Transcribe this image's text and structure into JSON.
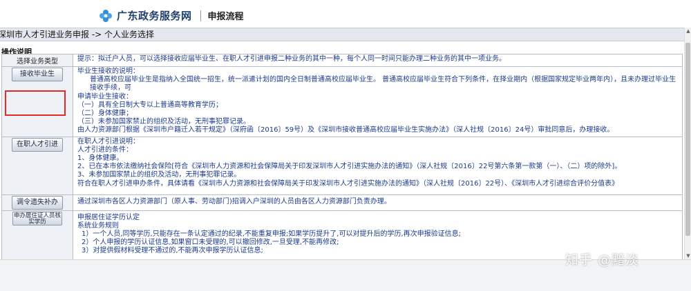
{
  "header": {
    "site_name": "广东政务服务网",
    "section": "申报流程"
  },
  "breadcrumb": "深圳市人才引进业务申报 -> 个人业务选择",
  "ops_title": "操作说明",
  "rows": [
    {
      "label": "选择业务类型",
      "lines": [
        "提示：拟迁户人员，可以选择接收应届毕业生、在职人才引进申报二种业务的其中一种，每个人同一时间只能办理二种业务的其中一项业务。"
      ]
    },
    {
      "label": "接收毕业生",
      "lines": [
        "毕业生接收的说明：",
        "普通高校应届毕业生是指纳入全国统一招生，统一派遣计划的国内全日制普通高校应届毕业生。 普通高校应届毕业生符合下列条件，在择业期内（根据国家规定毕业两年内），且未办理过毕业生接收手续，可",
        "申请毕业生接收：",
        "（一）具有全日制大专以上普通高等教育学历；",
        "（二）身体健康；",
        "（三）未参加国家禁止的组织及活动，无刑事犯罪记录。",
        "由人力资源部门根据《深圳市户籍迁入若干规定》（深府函〔2016〕59号）及《深圳市接收普通高校应届毕业生实施办法》（深人社规〔2016〕24号）审批同意后，办理接收。"
      ]
    },
    {
      "label": "在职人才引进",
      "lines": [
        "在职人才引进说明：",
        "人才引进的条件：",
        "1、身体健康。",
        "2、已在本市依法缴纳社会保险[符合《深圳市人力资源和社会保障局关于印发深圳市人才引进实施办法的通知》（深人社规〔2016〕22号第六条第一款第（一）、（二）项的除外]。",
        "3、未参加国家禁止的组织及活动，无刑事犯罪记录。",
        "符合在职人才引进申办条件，具体请看《深圳市人力资源和社会保障局关于印发深圳市人才引进实施办法的通知》（深人社规〔2016〕22号）、《深圳市人才引进综合评价分值表》"
      ]
    },
    {
      "label": "调令遗失补办",
      "lines": [
        "通过深圳市各区人力资源部门（原人事、劳动部门)招调入户深圳的人员由各区人力资源部门负责办理。"
      ]
    },
    {
      "label": "申办居住证人员核实学历",
      "lines": [
        "申报居住证学历认定",
        "系统业务规则",
        "1）一个人员,同等学历,只能存在一条认定通过的纪录,不能重复申报;如果学历提升了,可以对提升后的学历,再次申报验证信息;",
        "2）个人申报的学历认证信息,如果窗口未受理的,可以撤回修改,一旦受理,不能再修改;",
        "3）对提供假材料受理不通过的,不能再次申报学历认证信息;"
      ]
    }
  ],
  "watermark": "知乎 @黯淡",
  "colors": {
    "highlight": "#e02a2a",
    "link_text": "#1b3a8a",
    "logo_blue": "#2f8fd8"
  },
  "icons": [
    "logo-flower-icon"
  ]
}
